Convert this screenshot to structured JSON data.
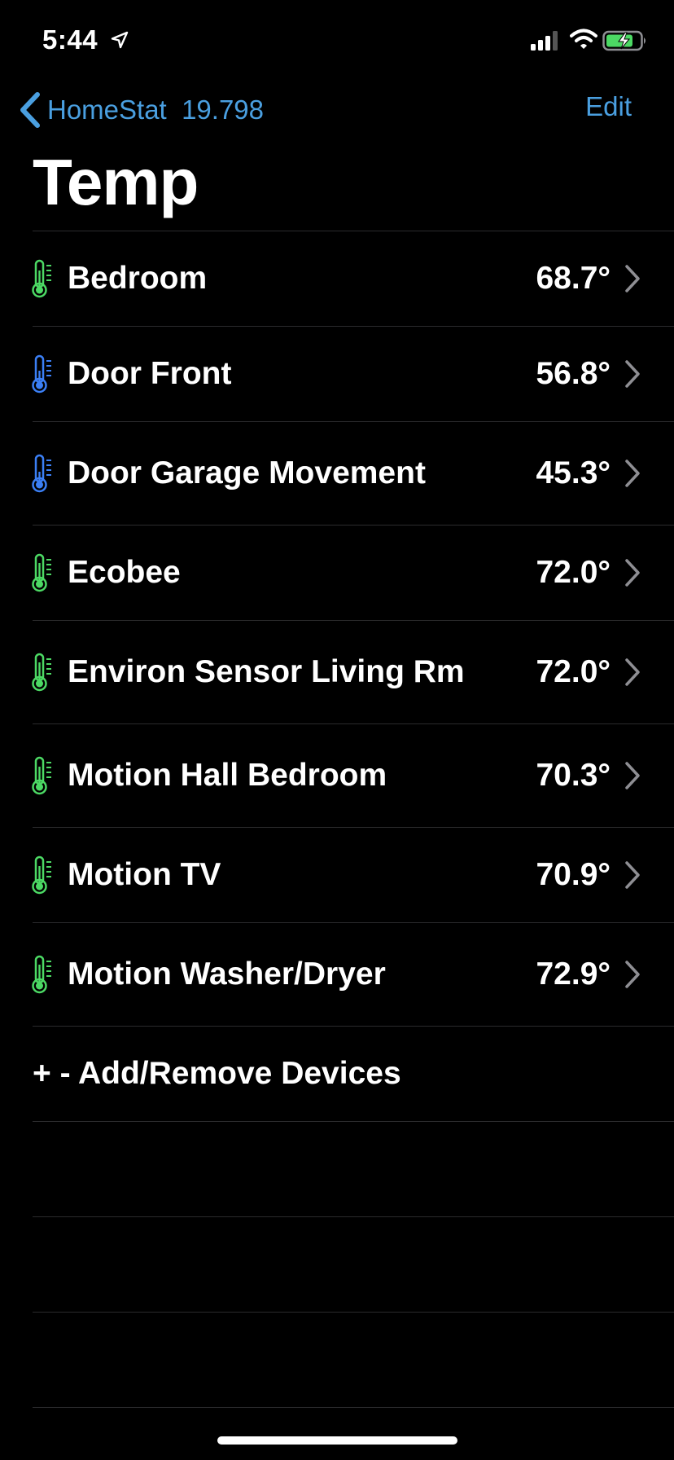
{
  "status_bar": {
    "time": "5:44",
    "icons": [
      "location-arrow-icon",
      "cellular-signal-icon",
      "wifi-icon",
      "battery-charging-icon"
    ],
    "battery_color": "#4cd964"
  },
  "nav": {
    "back_label": "HomeStat  19.798",
    "edit_label": "Edit",
    "accent_color": "#4a9fe0"
  },
  "page_title": "Temp",
  "devices": [
    {
      "name": "Bedroom",
      "value": "68.7°",
      "icon": "thermometer-icon",
      "icon_color": "#4cd964"
    },
    {
      "name": "Door Front",
      "value": "56.8°",
      "icon": "thermometer-icon",
      "icon_color": "#3b7ff5"
    },
    {
      "name": "Door Garage Movement",
      "value": "45.3°",
      "icon": "thermometer-icon",
      "icon_color": "#3b7ff5"
    },
    {
      "name": "Ecobee",
      "value": "72.0°",
      "icon": "thermometer-icon",
      "icon_color": "#4cd964"
    },
    {
      "name": "Environ Sensor Living Rm",
      "value": "72.0°",
      "icon": "thermometer-icon",
      "icon_color": "#4cd964"
    },
    {
      "name": "Motion Hall Bedroom",
      "value": "70.3°",
      "icon": "thermometer-icon",
      "icon_color": "#4cd964"
    },
    {
      "name": "Motion TV",
      "value": "70.9°",
      "icon": "thermometer-icon",
      "icon_color": "#4cd964"
    },
    {
      "name": "Motion Washer/Dryer",
      "value": "72.9°",
      "icon": "thermometer-icon",
      "icon_color": "#4cd964"
    }
  ],
  "add_remove_label": "+ - Add/Remove Devices"
}
